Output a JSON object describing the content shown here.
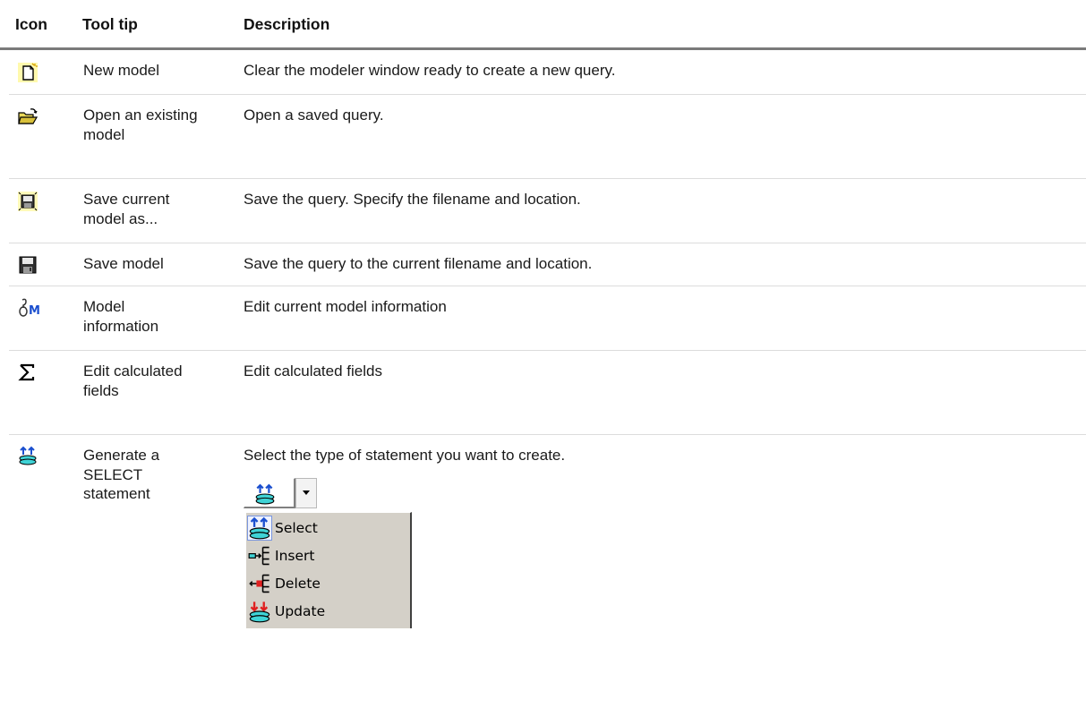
{
  "header": {
    "icon": "Icon",
    "tooltip": "Tool tip",
    "description": "Description"
  },
  "rows": [
    {
      "icon": "new-model-icon",
      "tooltip": "New model",
      "description": "Clear the modeler window ready to create a new query."
    },
    {
      "icon": "open-folder-icon",
      "tooltip": "Open an existing model",
      "description": "Open a saved query."
    },
    {
      "icon": "save-as-icon",
      "tooltip": "Save current model as...",
      "description": "Save the query. Specify the filename and location."
    },
    {
      "icon": "save-icon",
      "tooltip": "Save model",
      "description": "Save the query to the current filename and location."
    },
    {
      "icon": "model-info-icon",
      "tooltip": "Model information",
      "description": "Edit current model information"
    },
    {
      "icon": "sigma-icon",
      "tooltip": "Edit calculated fields",
      "description": "Edit calculated fields"
    },
    {
      "icon": "select-statement-icon",
      "tooltip": "Generate a SELECT statement",
      "description": "Select the type of statement you want to create."
    }
  ],
  "statement_menu": {
    "items": [
      {
        "label": "Select",
        "icon": "select-icon"
      },
      {
        "label": "Insert",
        "icon": "insert-icon"
      },
      {
        "label": "Delete",
        "icon": "delete-icon"
      },
      {
        "label": "Update",
        "icon": "update-icon"
      }
    ]
  },
  "colors": {
    "header_rule": "#7a7a7a",
    "row_divider": "#dcdcdc",
    "menu_bg": "#d4d0c8",
    "icon_blue": "#1b4fcf",
    "icon_cyan": "#3fd3d6"
  }
}
